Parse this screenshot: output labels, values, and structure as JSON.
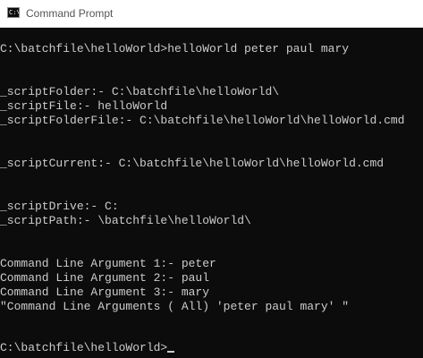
{
  "window": {
    "title": "Command Prompt",
    "icon": "C:\\_"
  },
  "console": {
    "command": "C:\\batchfile\\helloWorld>helloWorld peter paul mary",
    "script_folder": "_scriptFolder:- C:\\batchfile\\helloWorld\\",
    "script_file": "_scriptFile:- helloWorld",
    "script_folder_file": "_scriptFolderFile:- C:\\batchfile\\helloWorld\\helloWorld.cmd",
    "script_current": "_scriptCurrent:- C:\\batchfile\\helloWorld\\helloWorld.cmd",
    "script_drive": "_scriptDrive:- C:",
    "script_path": "_scriptPath:- \\batchfile\\helloWorld\\",
    "arg_1": "Command Line Argument 1:- peter",
    "arg_2": "Command Line Argument 2:- paul",
    "arg_3": "Command Line Argument 3:- mary",
    "all_args": "\"Command Line Arguments ( All) 'peter paul mary' \"",
    "prompt": "C:\\batchfile\\helloWorld>"
  }
}
